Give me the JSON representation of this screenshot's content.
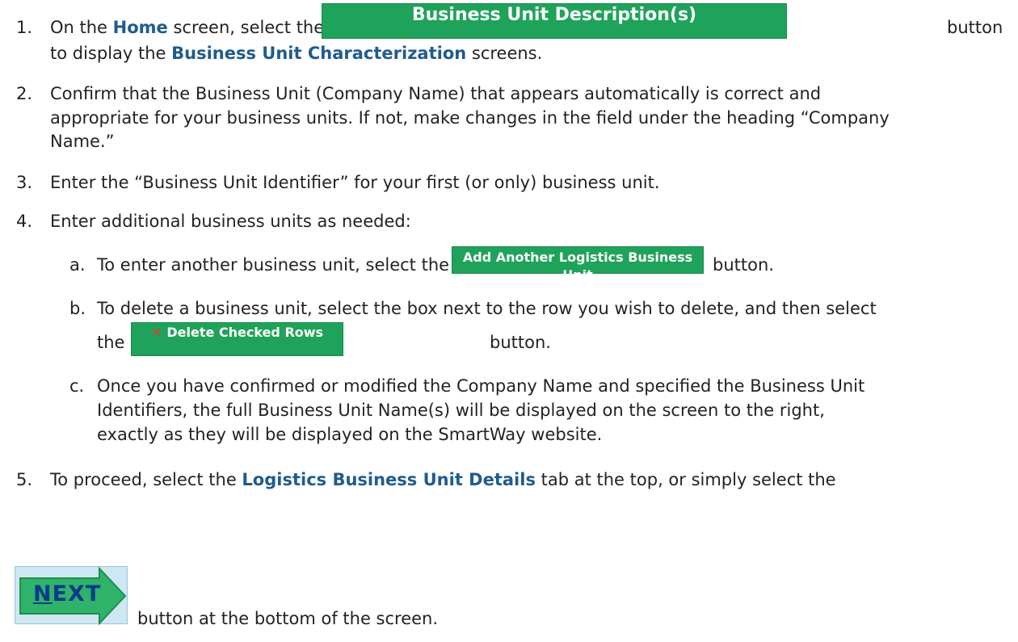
{
  "step1": {
    "num": "1.",
    "t1": "On the ",
    "home": "Home",
    "t2": " screen, select the",
    "button_label": "Business Unit Description(s)",
    "t3": "button",
    "line2_a": "to display the ",
    "characterization": "Business Unit Characterization",
    "line2_b": " screens."
  },
  "step2": {
    "num": "2.",
    "line1": "Confirm that the Business Unit (Company Name) that appears automatically is correct and",
    "line2": "appropriate for your business units.  If not, make changes in the field under the heading “Company",
    "line3": "Name.”"
  },
  "step3": {
    "num": "3.",
    "line1": "Enter the “Business Unit Identifier” for your first (or only) business unit."
  },
  "step4": {
    "num": "4.",
    "line1": "Enter additional business units as needed:",
    "a": {
      "num": "a.",
      "text": "To enter another business unit, select the",
      "button_label": "Add Another Logistics Business Unit",
      "after": "button."
    },
    "b": {
      "num": "b.",
      "line1": "To delete a business unit, select the box next to the row you wish to delete, and then select",
      "line2_a": "the",
      "button_icon": "✕",
      "button_label": "Delete Checked Rows",
      "line2_b": "button."
    },
    "c": {
      "num": "c.",
      "line1": "Once you have confirmed or modified the Company Name and specified the Business Unit",
      "line2": "Identifiers, the full Business Unit Name(s) will be displayed on the screen to the right,",
      "line3": "exactly as they will be displayed on the SmartWay website."
    }
  },
  "step5": {
    "num": "5.",
    "t1": "To proceed, select the ",
    "tab": "Logistics Business Unit Details",
    "t2": " tab at the top, or simply select the",
    "next_label_n": "N",
    "next_label_rest": "EXT",
    "after": "button at the bottom of the screen."
  },
  "colors": {
    "highlight": "#1f5b8f",
    "button_green": "#1fa35a",
    "delete_x_red": "#e23a2a",
    "next_bg": "#cfe7f3",
    "next_arrow": "#2fb36a"
  }
}
